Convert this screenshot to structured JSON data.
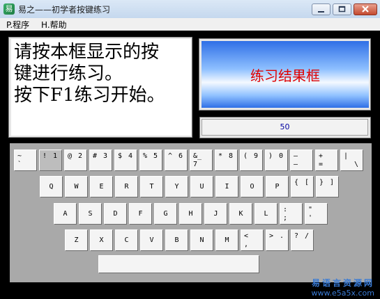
{
  "window": {
    "title": "易之——初学者按键练习",
    "app_icon": "易",
    "colors": {
      "titlebar": "#c5d8ee",
      "close": "#c34a2f",
      "result_text": "#e00000",
      "counter_text": "#0000a0"
    }
  },
  "menu": [
    {
      "label": "P.程序"
    },
    {
      "label": "H.帮助"
    }
  ],
  "instructions": {
    "line1": "请按本框显示的按",
    "line2": "键进行练习。",
    "line3": "按下F1练习开始。"
  },
  "result": {
    "label": "练习结果框"
  },
  "counter": {
    "value": "50"
  },
  "keyboard": {
    "row1": [
      {
        "a": "~",
        "c": "`"
      },
      {
        "a": "!",
        "b": "1",
        "active": true
      },
      {
        "a": "@",
        "b": "2"
      },
      {
        "a": "#",
        "b": "3"
      },
      {
        "a": "$",
        "b": "4"
      },
      {
        "a": "%",
        "b": "5"
      },
      {
        "a": "^",
        "b": "6"
      },
      {
        "a": "&_",
        "c": "7"
      },
      {
        "a": "*",
        "b": "8"
      },
      {
        "a": "(",
        "b": "9"
      },
      {
        "a": ")",
        "b": "0"
      },
      {
        "a": "—",
        "c": "–"
      },
      {
        "a": "+",
        "c": "="
      },
      {
        "a": "|",
        "d": "\\"
      }
    ],
    "row2": [
      {
        "m": "Q"
      },
      {
        "m": "W"
      },
      {
        "m": "E"
      },
      {
        "m": "R"
      },
      {
        "m": "T"
      },
      {
        "m": "Y"
      },
      {
        "m": "U"
      },
      {
        "m": "I"
      },
      {
        "m": "O"
      },
      {
        "m": "P"
      },
      {
        "a": "{",
        "b": "["
      },
      {
        "a": "}",
        "b": "]"
      }
    ],
    "row3": [
      {
        "m": "A"
      },
      {
        "m": "S"
      },
      {
        "m": "D"
      },
      {
        "m": "F"
      },
      {
        "m": "G"
      },
      {
        "m": "H"
      },
      {
        "m": "J"
      },
      {
        "m": "K"
      },
      {
        "m": "L"
      },
      {
        "a": ":",
        "c": ";"
      },
      {
        "a": "\"",
        "c": "'"
      }
    ],
    "row4": [
      {
        "m": "Z"
      },
      {
        "m": "X"
      },
      {
        "m": "C"
      },
      {
        "m": "V"
      },
      {
        "m": "B"
      },
      {
        "m": "N"
      },
      {
        "m": "M"
      },
      {
        "a": "<",
        "c": ","
      },
      {
        "a": ">",
        "b": "."
      },
      {
        "a": "?",
        "b": "/"
      }
    ],
    "space": {
      "m": ""
    }
  },
  "watermark": {
    "line1": "易语言资源网",
    "line2": "www.e5a5x.com"
  }
}
